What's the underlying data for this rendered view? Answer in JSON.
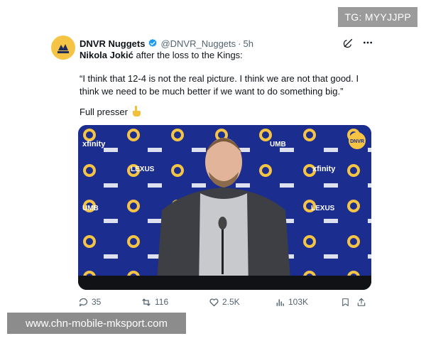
{
  "badge": {
    "text": "TG: MYYJJPP"
  },
  "tweet": {
    "display_name": "DNVR Nuggets",
    "handle": "@DNVR_Nuggets",
    "separator": "·",
    "time": "5h",
    "lead_name": "Nikola Jokić",
    "lead_rest": " after the loss to the Kings:",
    "quote": "“I think that 12-4 is not the real picture. I think we are not that good. I think we need to be much better if we want to do something big.”",
    "presser_label": "Full presser",
    "icons": {
      "avatar": "dnvr-logo",
      "verified": "verified-badge-icon",
      "grok": "grok-icon",
      "more": "more-icon",
      "hand": "pointing-down-hand-icon"
    },
    "media": {
      "backdrop_brand_text": [
        "xfinity",
        "LEXUS",
        "UMB",
        "xfinity",
        "LEXUS",
        "UMB"
      ],
      "corner_badge": "DNVR"
    },
    "actions": {
      "replies": "35",
      "reposts": "116",
      "likes": "2.5K",
      "views": "103K"
    }
  },
  "watermark": {
    "text": "www.chn-mobile-mksport.com"
  },
  "colors": {
    "text": "#0f1419",
    "muted": "#536471",
    "verified": "#1d9bf0",
    "backdrop": "#1a2a8c",
    "avatar": "#f6c445"
  }
}
